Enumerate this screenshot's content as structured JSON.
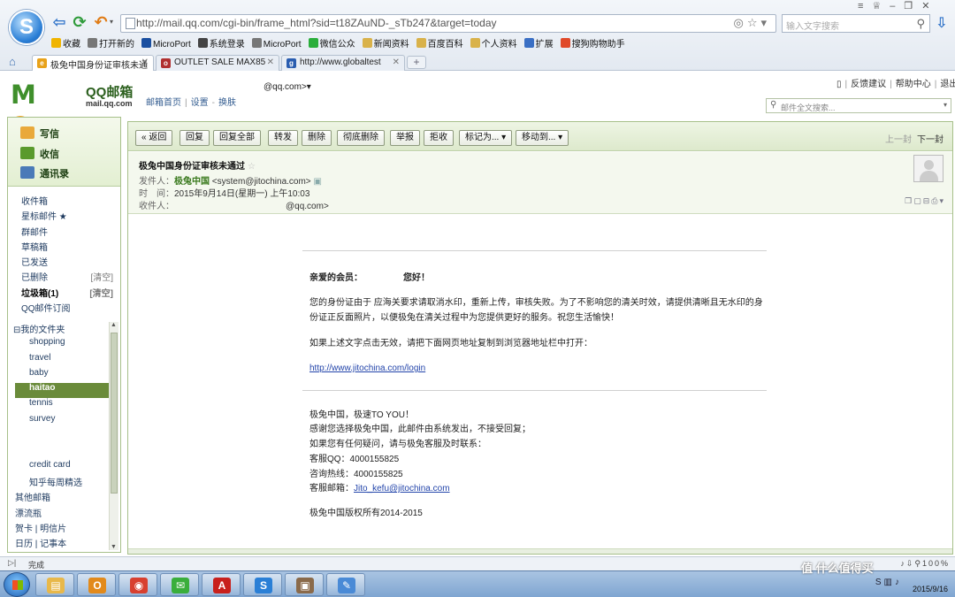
{
  "browser": {
    "url": "http://mail.qq.com/cgi-bin/frame_html?sid=t18ZAuND-_sTb247&target=today",
    "search_placeholder": "输入文字搜索",
    "bookmarks": [
      {
        "label": "收藏",
        "icon": "star-icon",
        "color": "#f0b400"
      },
      {
        "label": "打开新的",
        "icon": "page-icon",
        "color": "#777777"
      },
      {
        "label": "MicroPort",
        "icon": "microport-icon",
        "color": "#1a4fa0"
      },
      {
        "label": "系统登录",
        "icon": "k-icon",
        "color": "#444444"
      },
      {
        "label": "MicroPort",
        "icon": "page-icon",
        "color": "#777777"
      },
      {
        "label": "微信公众",
        "icon": "wechat-icon",
        "color": "#2aae3b"
      },
      {
        "label": "新闻资料",
        "icon": "folder-icon",
        "color": "#d9b24a"
      },
      {
        "label": "百度百科",
        "icon": "folder-icon",
        "color": "#d9b24a"
      },
      {
        "label": "个人资料",
        "icon": "folder-icon",
        "color": "#d9b24a"
      },
      {
        "label": "扩展",
        "icon": "grid-icon",
        "color": "#3a6fc4"
      },
      {
        "label": "搜狗购物助手",
        "icon": "shopping-icon",
        "color": "#e04a2a"
      }
    ],
    "tabs": [
      {
        "label": "极兔中国身份证审核未通",
        "favicon_color": "#e8a21a",
        "favicon": "e"
      },
      {
        "label": "OUTLET SALE MAX85",
        "favicon_color": "#b03030",
        "favicon": "o"
      },
      {
        "label": "http://www.globaltest",
        "favicon_color": "#2a5db0",
        "favicon": "g"
      }
    ],
    "status_text": "完成",
    "status_right": "100%"
  },
  "mail_header": {
    "logo_text": "MOil",
    "logo_name": "QQ邮箱",
    "logo_domain": "mail.qq.com",
    "account_email": "@qq.com>",
    "links": [
      "邮箱首页",
      "设置",
      "换肤"
    ],
    "top_right_links": [
      "反馈建议",
      "帮助中心",
      "退出"
    ],
    "fulltext_search_placeholder": "邮件全文搜索..."
  },
  "sidebar": {
    "actions": [
      {
        "label": "写信",
        "icon": "compose-icon",
        "color": "#e9a93a"
      },
      {
        "label": "收信",
        "icon": "inbox-icon",
        "color": "#5a9a2c"
      },
      {
        "label": "通讯录",
        "icon": "contacts-icon",
        "color": "#4a7ab8"
      }
    ],
    "folders": [
      {
        "label": "收件箱",
        "extra": ""
      },
      {
        "label": "星标邮件 ★",
        "extra": ""
      },
      {
        "label": "群邮件",
        "extra": ""
      },
      {
        "label": "草稿箱",
        "extra": ""
      },
      {
        "label": "已发送",
        "extra": ""
      },
      {
        "label": "已删除",
        "extra": "[清空]"
      },
      {
        "label": "垃圾箱(1)",
        "extra": "[清空]",
        "bold": true
      },
      {
        "label": "QQ邮件订阅",
        "extra": ""
      }
    ],
    "my_folders_label": "⊟我的文件夹",
    "my_folders": [
      "shopping",
      "travel",
      "baby",
      "haitao",
      "tennis",
      "survey",
      "",
      "",
      "credit card",
      "知乎每周精选"
    ],
    "active_folder": "haitao",
    "more_items": [
      "其他邮箱",
      "漂流瓶",
      "贺卡 | 明信片",
      "日历 | 记事本"
    ]
  },
  "toolbar": {
    "buttons": [
      "« 返回",
      "回复",
      "回复全部",
      "转发",
      "删除",
      "彻底删除",
      "举报",
      "拒收",
      "标记为... ▾",
      "移动到... ▾"
    ],
    "prev": "上一封",
    "next": "下一封"
  },
  "mail": {
    "subject": "极兔中国身份证审核未通过",
    "from_label": "发件人：",
    "from_name": "极兔中国",
    "from_addr": "<system@jitochina.com>",
    "time_label": "时　间：",
    "time_value": "2015年9月14日(星期一) 上午10:03",
    "to_label": "收件人：",
    "to_value": "@qq.com>"
  },
  "body": {
    "greeting_left": "亲爱的会员：",
    "greeting_right": "您好！",
    "para1_line1": "您的身份证由于 应海关要求请取消水印，重新上传，审核失败。为了不影响您的清关时效，请提供清晰且无水印的身",
    "para1_line2": "份证正反面照片，以便极兔在清关过程中为您提供更好的服务。祝您生活愉快！",
    "para2": "如果上述文字点击无效，请把下面网页地址复制到浏览器地址栏中打开：",
    "link": "http://www.jitochina.com/login",
    "footer1": "极兔中国，极速TO YOU！",
    "footer2": "感谢您选择极兔中国，此邮件由系统发出，不接受回复；",
    "footer3": "如果您有任何疑问，请与极兔客服及时联系：",
    "footer4": "客服QQ：4000155825",
    "footer5": "咨询热线：4000155825",
    "footer6_label": "客服邮箱：",
    "footer6_link": "Jito_kefu@jitochina.com",
    "footer7": "极兔中国版权所有2014-2015"
  },
  "taskbar": {
    "date": "2015/9/16",
    "watermark": "值 什么值得买",
    "apps": [
      {
        "name": "explorer-icon",
        "color": "#e8b84a",
        "glyph": "▤"
      },
      {
        "name": "outlook-icon",
        "color": "#e28a1c",
        "glyph": "O"
      },
      {
        "name": "chrome-icon",
        "color": "#d8402f",
        "glyph": "◉"
      },
      {
        "name": "wechat-icon",
        "color": "#3aae3b",
        "glyph": "✉"
      },
      {
        "name": "pdf-icon",
        "color": "#c8201c",
        "glyph": "A"
      },
      {
        "name": "sogou-browser-icon",
        "color": "#2a7fd6",
        "glyph": "S"
      },
      {
        "name": "photo-viewer-icon",
        "color": "#8a6a4a",
        "glyph": "▣"
      },
      {
        "name": "paint-icon",
        "color": "#4a8ad6",
        "glyph": "✎"
      }
    ]
  }
}
